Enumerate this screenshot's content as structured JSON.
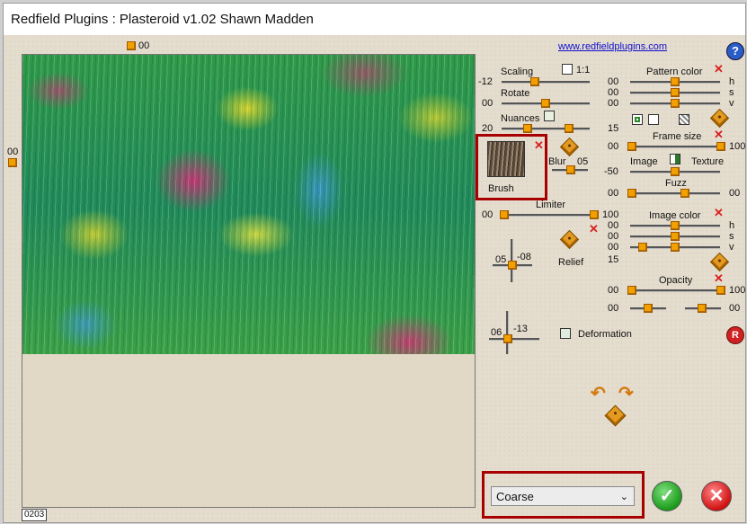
{
  "window": {
    "title": "Redfield Plugins : Plasteroid v1.02   Shawn Madden"
  },
  "preview": {
    "x_offset": "00",
    "y_offset": "00",
    "counter": "0203"
  },
  "website": "www.redfieldplugins.com",
  "scaling": {
    "label": "Scaling",
    "value": "-12",
    "lock_label": "1:1"
  },
  "rotate": {
    "label": "Rotate",
    "value": "00"
  },
  "third": {
    "value": "00"
  },
  "nuances": {
    "label": "Nuances",
    "value_left": "20",
    "value_right": "15"
  },
  "brush": {
    "label": "Brush",
    "blur_label": "Blur",
    "blur_value": "05"
  },
  "limiter": {
    "label": "Limiter",
    "min": "00",
    "max": "100"
  },
  "relief": {
    "label": "Relief",
    "x": "05",
    "y": "-08"
  },
  "deformation": {
    "label": "Deformation",
    "x": "06",
    "y": "-13"
  },
  "pattern_color": {
    "label": "Pattern color",
    "h": "00",
    "s": "00",
    "v": "00",
    "h_label": "h",
    "s_label": "s",
    "v_label": "v"
  },
  "frame_size": {
    "label": "Frame size",
    "min": "00",
    "max": "100"
  },
  "image_texture": {
    "image_label": "Image",
    "texture_label": "Texture",
    "value": "-50"
  },
  "fuzz": {
    "label": "Fuzz",
    "min": "00",
    "max": "00"
  },
  "image_color": {
    "label": "Image color",
    "h": "00",
    "s": "00",
    "v": "00",
    "h_label": "h",
    "s_label": "s",
    "v_label": "v",
    "extra": "15"
  },
  "opacity": {
    "label": "Opacity",
    "min": "00",
    "max": "100",
    "row2_left": "00",
    "row2_right": "00"
  },
  "combo": {
    "value": "Coarse"
  },
  "colors": {
    "accent": "#f2a000",
    "highlight_frame": "#a80000"
  }
}
